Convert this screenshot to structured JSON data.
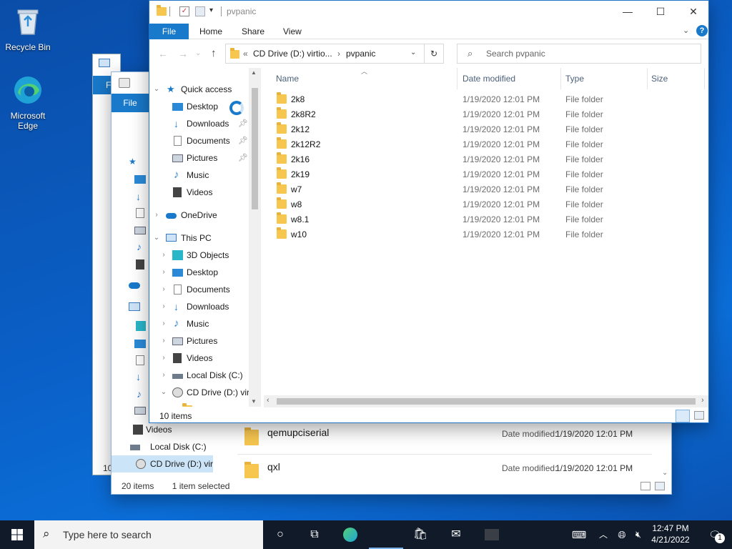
{
  "desktop": {
    "icons": [
      {
        "label": "Recycle Bin"
      },
      {
        "label": "Microsoft Edge"
      }
    ]
  },
  "back_window": {
    "ribbon_file": "File",
    "nav_items": [
      {
        "label": "Videos"
      },
      {
        "label": "Local Disk (C:)"
      },
      {
        "label": "CD Drive (D:) virt"
      }
    ],
    "entries": [
      {
        "name": "qemupciserial",
        "date_label": "Date modified:",
        "date": "1/19/2020 12:01 PM"
      },
      {
        "name": "qxl",
        "date_label": "Date modified:",
        "date": "1/19/2020 12:01 PM"
      }
    ],
    "status": {
      "count": "20 items",
      "selected": "1 item selected"
    },
    "partial_left_labels": [
      "Fi",
      "10",
      "C",
      "C",
      "T"
    ]
  },
  "window": {
    "title": "pvpanic",
    "ribbon_tabs": [
      "File",
      "Home",
      "Share",
      "View"
    ],
    "address": {
      "prefix": "«",
      "crumb1": "CD Drive (D:) virtio...",
      "sep": "›",
      "crumb2": "pvpanic"
    },
    "search_placeholder": "Search pvpanic",
    "columns": {
      "name": "Name",
      "date": "Date modified",
      "type": "Type",
      "size": "Size"
    },
    "nav": {
      "quick_access": "Quick access",
      "quick_items": [
        "Desktop",
        "Downloads",
        "Documents",
        "Pictures",
        "Music",
        "Videos"
      ],
      "onedrive": "OneDrive",
      "this_pc": "This PC",
      "pc_items": [
        "3D Objects",
        "Desktop",
        "Documents",
        "Downloads",
        "Music",
        "Pictures",
        "Videos",
        "Local Disk (C:)",
        "CD Drive (D:) virt"
      ]
    },
    "files": [
      {
        "name": "2k8",
        "date": "1/19/2020 12:01 PM",
        "type": "File folder"
      },
      {
        "name": "2k8R2",
        "date": "1/19/2020 12:01 PM",
        "type": "File folder"
      },
      {
        "name": "2k12",
        "date": "1/19/2020 12:01 PM",
        "type": "File folder"
      },
      {
        "name": "2k12R2",
        "date": "1/19/2020 12:01 PM",
        "type": "File folder"
      },
      {
        "name": "2k16",
        "date": "1/19/2020 12:01 PM",
        "type": "File folder"
      },
      {
        "name": "2k19",
        "date": "1/19/2020 12:01 PM",
        "type": "File folder"
      },
      {
        "name": "w7",
        "date": "1/19/2020 12:01 PM",
        "type": "File folder"
      },
      {
        "name": "w8",
        "date": "1/19/2020 12:01 PM",
        "type": "File folder"
      },
      {
        "name": "w8.1",
        "date": "1/19/2020 12:01 PM",
        "type": "File folder"
      },
      {
        "name": "w10",
        "date": "1/19/2020 12:01 PM",
        "type": "File folder"
      }
    ],
    "status": "10 items"
  },
  "taskbar": {
    "search_placeholder": "Type here to search",
    "time": "12:47 PM",
    "date": "4/21/2022",
    "notification_count": "1"
  },
  "colors": {
    "accent": "#1979ca",
    "folder": "#f6c64f",
    "taskbar": "#101a28"
  }
}
